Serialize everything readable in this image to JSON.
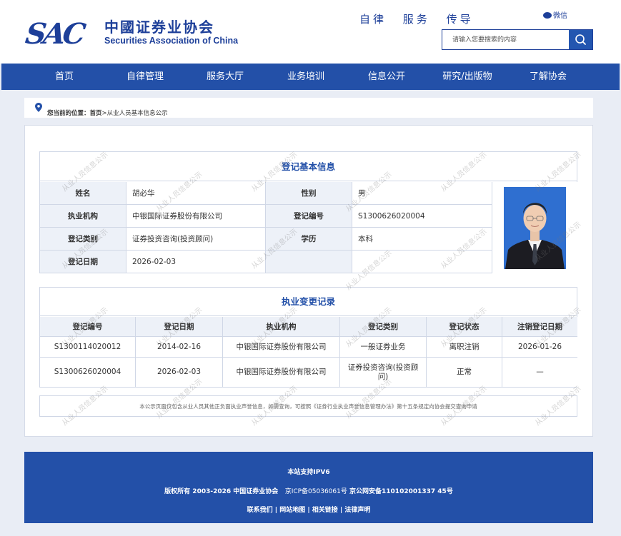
{
  "header": {
    "logo_cn": "中國证券业协会",
    "logo_en": "Securities Association of China",
    "logo_abbr": "SAC",
    "slogan": [
      "自律",
      "服务",
      "传导"
    ],
    "wechat_label": "微信",
    "search_placeholder": "请输入您要搜索的内容"
  },
  "nav": {
    "items": [
      "首页",
      "自律管理",
      "服务大厅",
      "业务培训",
      "信息公开",
      "研究/出版物",
      "了解协会"
    ]
  },
  "breadcrumb": {
    "prefix": "您当前的位置：",
    "home": "首页",
    "separator": ">",
    "current": "从业人员基本信息公示"
  },
  "basic_info": {
    "title": "登记基本信息",
    "labels": {
      "name": "姓名",
      "gender": "性别",
      "org": "执业机构",
      "reg_no": "登记编号",
      "category": "登记类别",
      "education": "学历",
      "reg_date": "登记日期"
    },
    "values": {
      "name": "胡必华",
      "gender": "男",
      "org": "中银国际证券股份有限公司",
      "reg_no": "S1300626020004",
      "category": "证券投资咨询(投资顾问)",
      "education": "本科",
      "reg_date": "2026-02-03"
    }
  },
  "change_records": {
    "title": "执业变更记录",
    "columns": [
      "登记编号",
      "登记日期",
      "执业机构",
      "登记类别",
      "登记状态",
      "注销登记日期"
    ],
    "rows": [
      [
        "S1300114020012",
        "2014-02-16",
        "中银国际证券股份有限公司",
        "一般证券业务",
        "离职注销",
        "2026-01-26"
      ],
      [
        "S1300626020004",
        "2026-02-03",
        "中银国际证券股份有限公司",
        "证券投资咨询(投资顾问)",
        "正常",
        "—"
      ]
    ]
  },
  "notice": "本公示页面仅包含从业人员其他正负面执业声誉信息，如需查询，可按照《证券行业执业声誉信息管理办法》第十五条规定向协会提交查询申请",
  "watermark_text": "从业人员信息公示",
  "footer": {
    "ipv6": "本站支持IPV6",
    "copyright_bold": "版权所有 2003-2026 中国证券业协会",
    "icp": "京ICP备05036061号",
    "police": "京公网安备110102001337 45号",
    "links": [
      "联系我们",
      "网站地图",
      "相关链接",
      "法律声明"
    ]
  },
  "colors": {
    "brand_blue": "#2350a8",
    "label_bg": "#edf1f8",
    "page_bg": "#e9edf5"
  }
}
